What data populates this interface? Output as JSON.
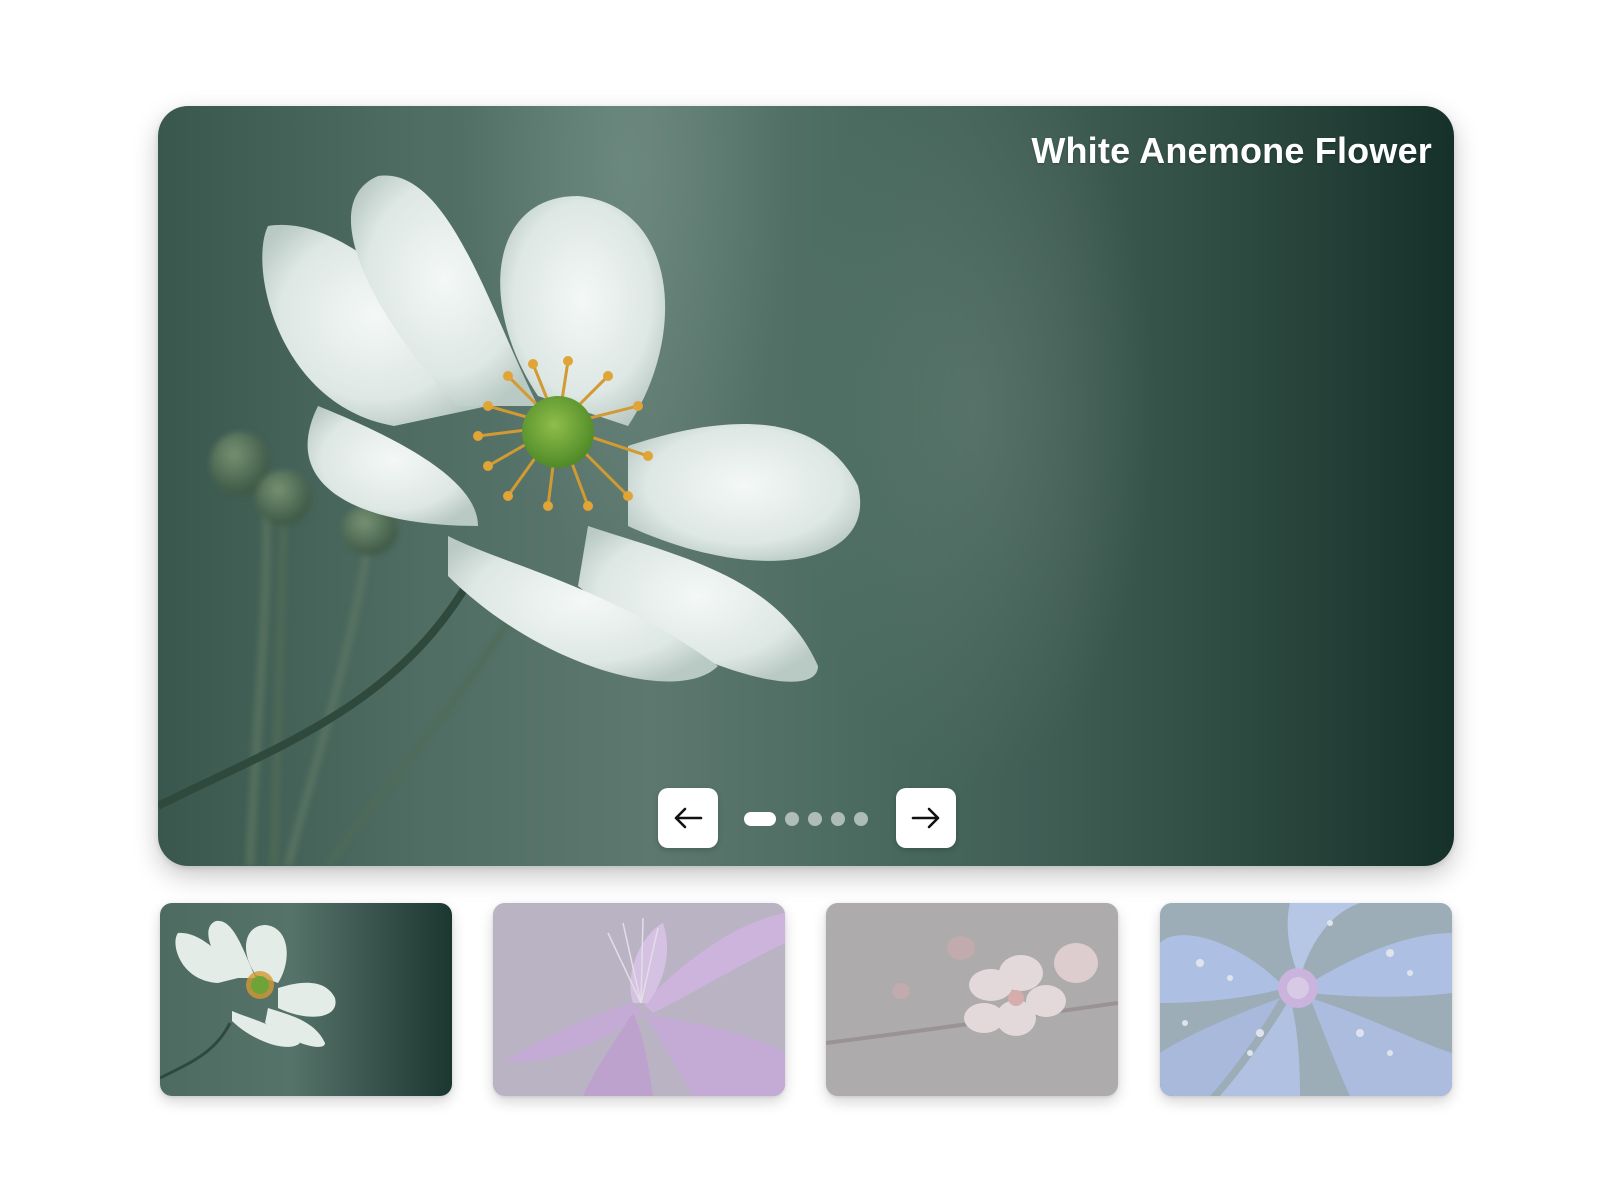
{
  "slider": {
    "title": "White Anemone Flower",
    "active_index": 0,
    "slide_count": 5
  },
  "navigation": {
    "prev_icon": "arrow-left-icon",
    "next_icon": "arrow-right-icon"
  },
  "thumbnails": [
    {
      "subject": "white-anemone",
      "active": true
    },
    {
      "subject": "purple-lily",
      "active": false
    },
    {
      "subject": "pink-blossom",
      "active": false
    },
    {
      "subject": "blue-dewdrop-flower",
      "active": false
    }
  ],
  "colors": {
    "title_text": "#ffffff",
    "button_bg": "#ffffff",
    "dot_active": "#ffffff",
    "dot_inactive": "#b5c4be",
    "slide_bg_dark": "#16302a",
    "slide_bg_mid": "#5d786f"
  }
}
